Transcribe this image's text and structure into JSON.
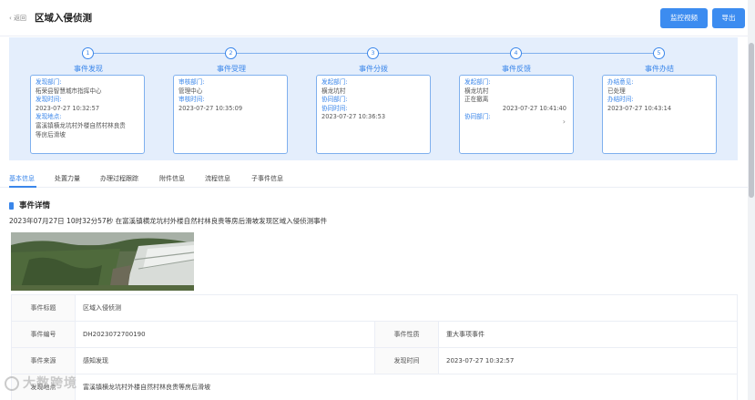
{
  "header": {
    "back_label": "返回",
    "title": "区域入侵侦测",
    "monitor_button": "监控视频",
    "export_button": "导出"
  },
  "steps": [
    {
      "number": "1",
      "title": "事件发现",
      "lines": [
        {
          "label": "发现部门:",
          "value": ""
        },
        {
          "label": "",
          "value": "柘荣县智慧城市指挥中心"
        },
        {
          "label": "发现时间:",
          "value": ""
        },
        {
          "label": "",
          "value": "2023-07-27 10:32:57"
        },
        {
          "label": "发现地点:",
          "value": ""
        },
        {
          "label": "",
          "value": "富溪镇横龙坑村外楼自然村林良贵"
        },
        {
          "label": "",
          "value": "等房后滑坡"
        }
      ]
    },
    {
      "number": "2",
      "title": "事件受理",
      "lines": [
        {
          "label": "审核部门:",
          "value": ""
        },
        {
          "label": "",
          "value": "管理中心"
        },
        {
          "label": "审核时间:",
          "value": ""
        },
        {
          "label": "",
          "value": "2023-07-27 10:35:09"
        }
      ]
    },
    {
      "number": "3",
      "title": "事件分拨",
      "lines": [
        {
          "label": "发起部门:",
          "value": ""
        },
        {
          "label": "",
          "value": "横龙坑村"
        },
        {
          "label": "协同部门:",
          "value": ""
        },
        {
          "label": "",
          "value": ""
        },
        {
          "label": "协同时间:",
          "value": ""
        },
        {
          "label": "",
          "value": "2023-07-27 10:36:53"
        }
      ]
    },
    {
      "number": "4",
      "title": "事件反馈",
      "lines": [
        {
          "label": "发起部门:",
          "value": ""
        },
        {
          "label": "",
          "value": "横龙坑村"
        },
        {
          "label": "",
          "value": "正在撤离"
        },
        {
          "label": "",
          "value": "                    2023-07-27 10:41:40"
        },
        {
          "label": "协同部门:",
          "value": ""
        }
      ]
    },
    {
      "number": "5",
      "title": "事件办结",
      "lines": [
        {
          "label": "办结意见:",
          "value": ""
        },
        {
          "label": "",
          "value": "已处理"
        },
        {
          "label": "办结时间:",
          "value": ""
        },
        {
          "label": "",
          "value": "2023-07-27 10:43:14"
        }
      ]
    }
  ],
  "tabs": [
    "基本信息",
    "处置力量",
    "办理过程跟踪",
    "附件信息",
    "流程信息",
    "子事件信息"
  ],
  "section": {
    "title": "事件详情",
    "description": "2023年07月27日 10时32分57秒 在富溪镇横龙坑村外楼自然村林良贵等房后滑坡发现区域入侵侦测事件"
  },
  "details": {
    "event_title_key": "事件标题",
    "event_title_val": "区域入侵侦测",
    "event_no_key": "事件编号",
    "event_no_val": "DH2023072700190",
    "event_nature_key": "事件性质",
    "event_nature_val": "重大事项事件",
    "event_source_key": "事件来源",
    "event_source_val": "感知发现",
    "found_time_key": "发现时间",
    "found_time_val": "2023-07-27 10:32:57",
    "found_place_key": "发现地点",
    "found_place_val": "富溪镇横龙坑村外楼自然村林良贵等房后滑坡"
  },
  "watermark": "大数跨境",
  "colors": {
    "accent": "#3a86ea",
    "panel_bg": "#e4eefc",
    "button_bg": "#3c8cf0"
  }
}
